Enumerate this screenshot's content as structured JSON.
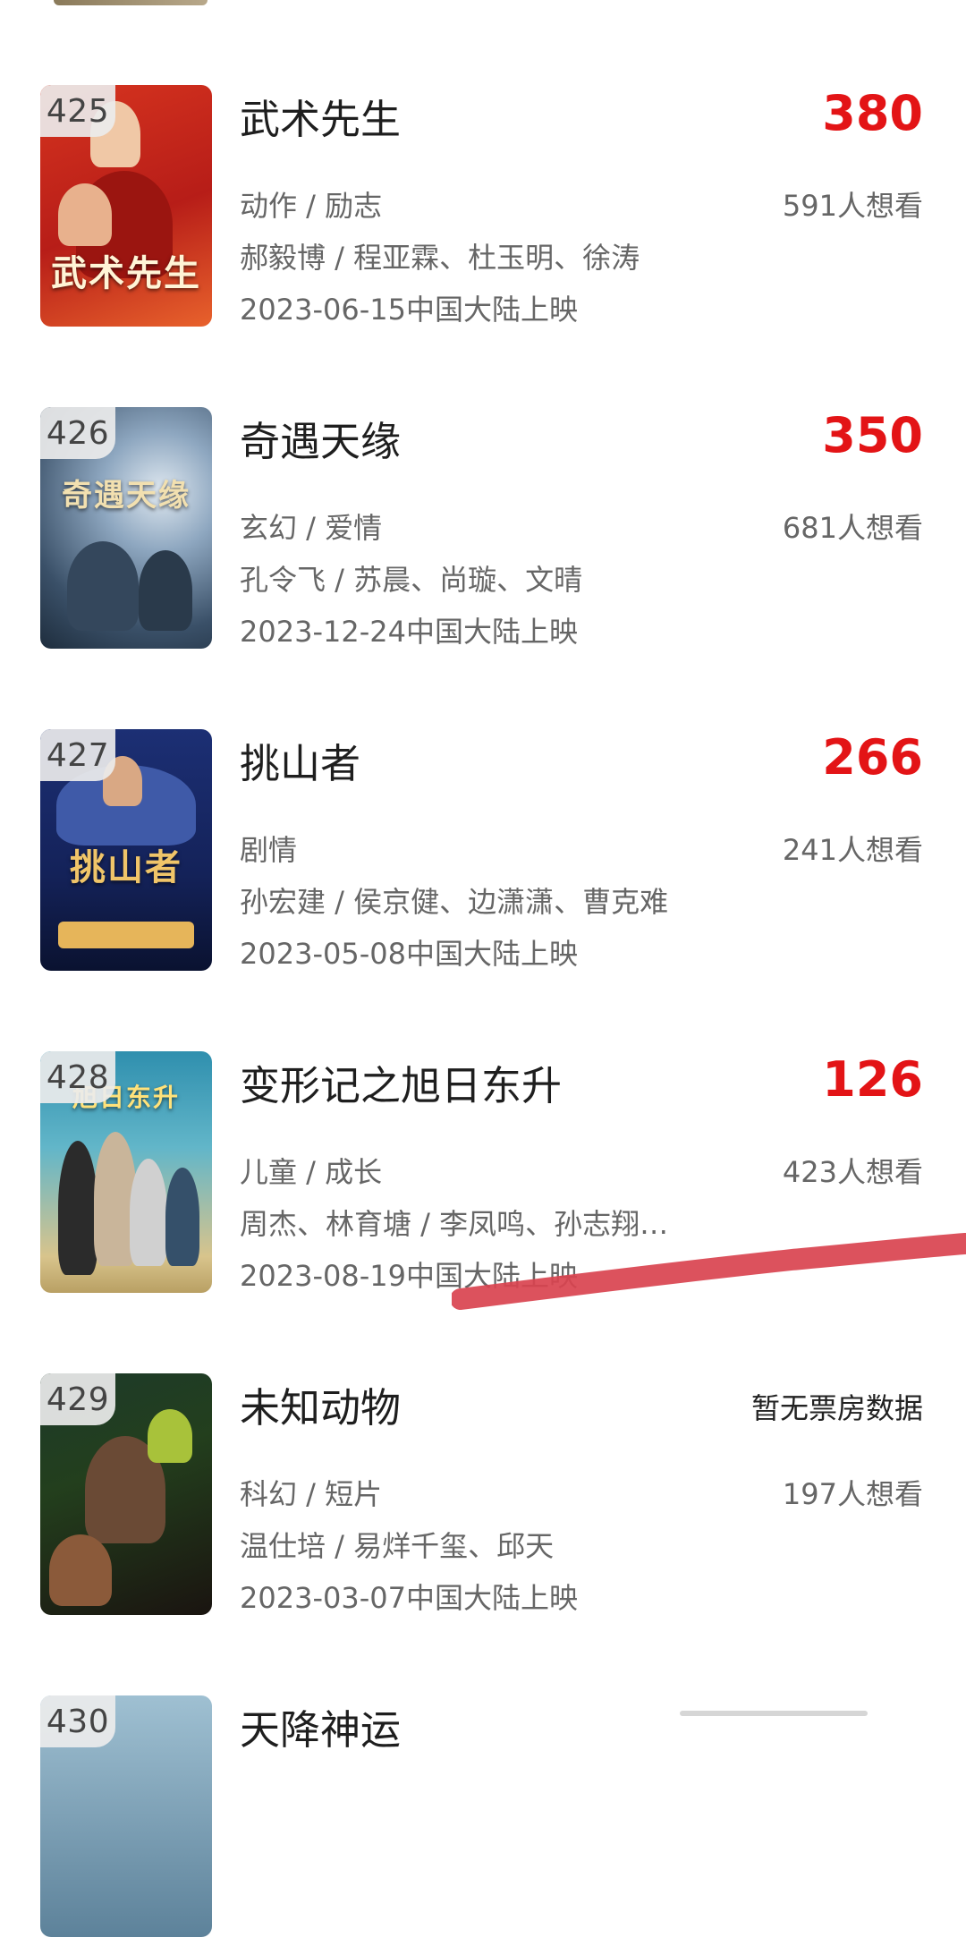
{
  "items": [
    {
      "rank": "425",
      "title": "武术先生",
      "value": "380",
      "genre": "动作 / 励志",
      "want": "591人想看",
      "cast": "郝毅博 / 程亚霖、杜玉明、徐涛",
      "release": "2023-06-15中国大陆上映",
      "poster_colors": [
        "#c8261e",
        "#e85a2a"
      ]
    },
    {
      "rank": "426",
      "title": "奇遇天缘",
      "value": "350",
      "genre": "玄幻 / 爱情",
      "want": "681人想看",
      "cast": "孔令飞 / 苏晨、尚璇、文晴",
      "release": "2023-12-24中国大陆上映",
      "poster_colors": [
        "#7f97b3",
        "#2c3f55"
      ]
    },
    {
      "rank": "427",
      "title": "挑山者",
      "value": "266",
      "genre": "剧情",
      "want": "241人想看",
      "cast": "孙宏建 / 侯京健、边潇潇、曹克难",
      "release": "2023-05-08中国大陆上映",
      "poster_colors": [
        "#1a2a66",
        "#0c1433"
      ]
    },
    {
      "rank": "428",
      "title": "变形记之旭日东升",
      "value": "126",
      "genre": "儿童 / 成长",
      "want": "423人想看",
      "cast": "周杰、林育塘 / 李凤鸣、孙志翔…",
      "release": "2023-08-19中国大陆上映",
      "poster_colors": [
        "#3b9ab2",
        "#d6b56a"
      ]
    },
    {
      "rank": "429",
      "title": "未知动物",
      "value": "暂无票房数据",
      "genre": "科幻 / 短片",
      "want": "197人想看",
      "cast": "温仕培 / 易烊千玺、邱天",
      "release": "2023-03-07中国大陆上映",
      "poster_colors": [
        "#1f3a2a",
        "#0d1a12"
      ]
    },
    {
      "rank": "430",
      "title": "天降神运",
      "value": "",
      "genre": "",
      "want": "",
      "cast": "",
      "release": "",
      "poster_colors": [
        "#8fb3c7",
        "#4c6f86"
      ]
    }
  ],
  "accent_color": "#e31416",
  "annotation": {
    "stroke_color": "#d9434f"
  }
}
